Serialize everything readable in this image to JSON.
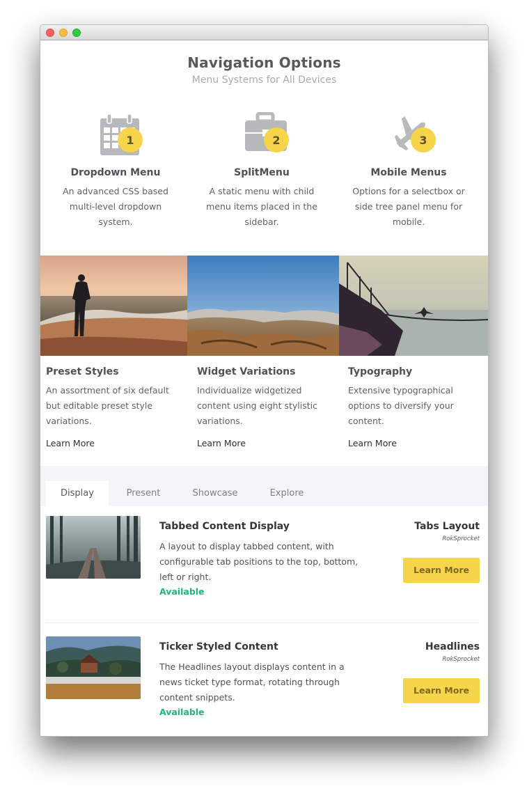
{
  "header": {
    "title": "Navigation Options",
    "subtitle": "Menu Systems for All Devices"
  },
  "features": [
    {
      "icon": "calendar-icon",
      "badge": "1",
      "title": "Dropdown Menu",
      "desc": "An advanced CSS based multi-level dropdown system."
    },
    {
      "icon": "briefcase-icon",
      "badge": "2",
      "title": "SplitMenu",
      "desc": "A static menu with child menu items placed in the sidebar."
    },
    {
      "icon": "airplane-icon",
      "badge": "3",
      "title": "Mobile Menus",
      "desc": "Options for a selectbox or side tree panel menu for mobile."
    }
  ],
  "columns": [
    {
      "title": "Preset Styles",
      "desc": "An assortment of six default but editable preset style variations.",
      "link": "Learn More"
    },
    {
      "title": "Widget Variations",
      "desc": "Individualize widgetized content using eight stylistic variations.",
      "link": "Learn More"
    },
    {
      "title": "Typography",
      "desc": "Extensive typographical options to diversify your content.",
      "link": "Learn More"
    }
  ],
  "tabs": [
    {
      "label": "Display",
      "active": true
    },
    {
      "label": "Present",
      "active": false
    },
    {
      "label": "Showcase",
      "active": false
    },
    {
      "label": "Explore",
      "active": false
    }
  ],
  "items": [
    {
      "title": "Tabbed Content Display",
      "desc": "A layout to display tabbed content, with configurable tab positions to the top, bottom, left or right.",
      "status": "Available",
      "label": "Tabs Layout",
      "sub": "RokSprocket",
      "button": "Learn More"
    },
    {
      "title": "Ticker Styled Content",
      "desc": "The Headlines layout displays content in a news ticket type format, rotating through content snippets.",
      "status": "Available",
      "label": "Headlines",
      "sub": "RokSprocket",
      "button": "Learn More"
    }
  ],
  "colors": {
    "accent": "#f7d54a",
    "available": "#1fb57c",
    "heading": "#555a5e"
  }
}
